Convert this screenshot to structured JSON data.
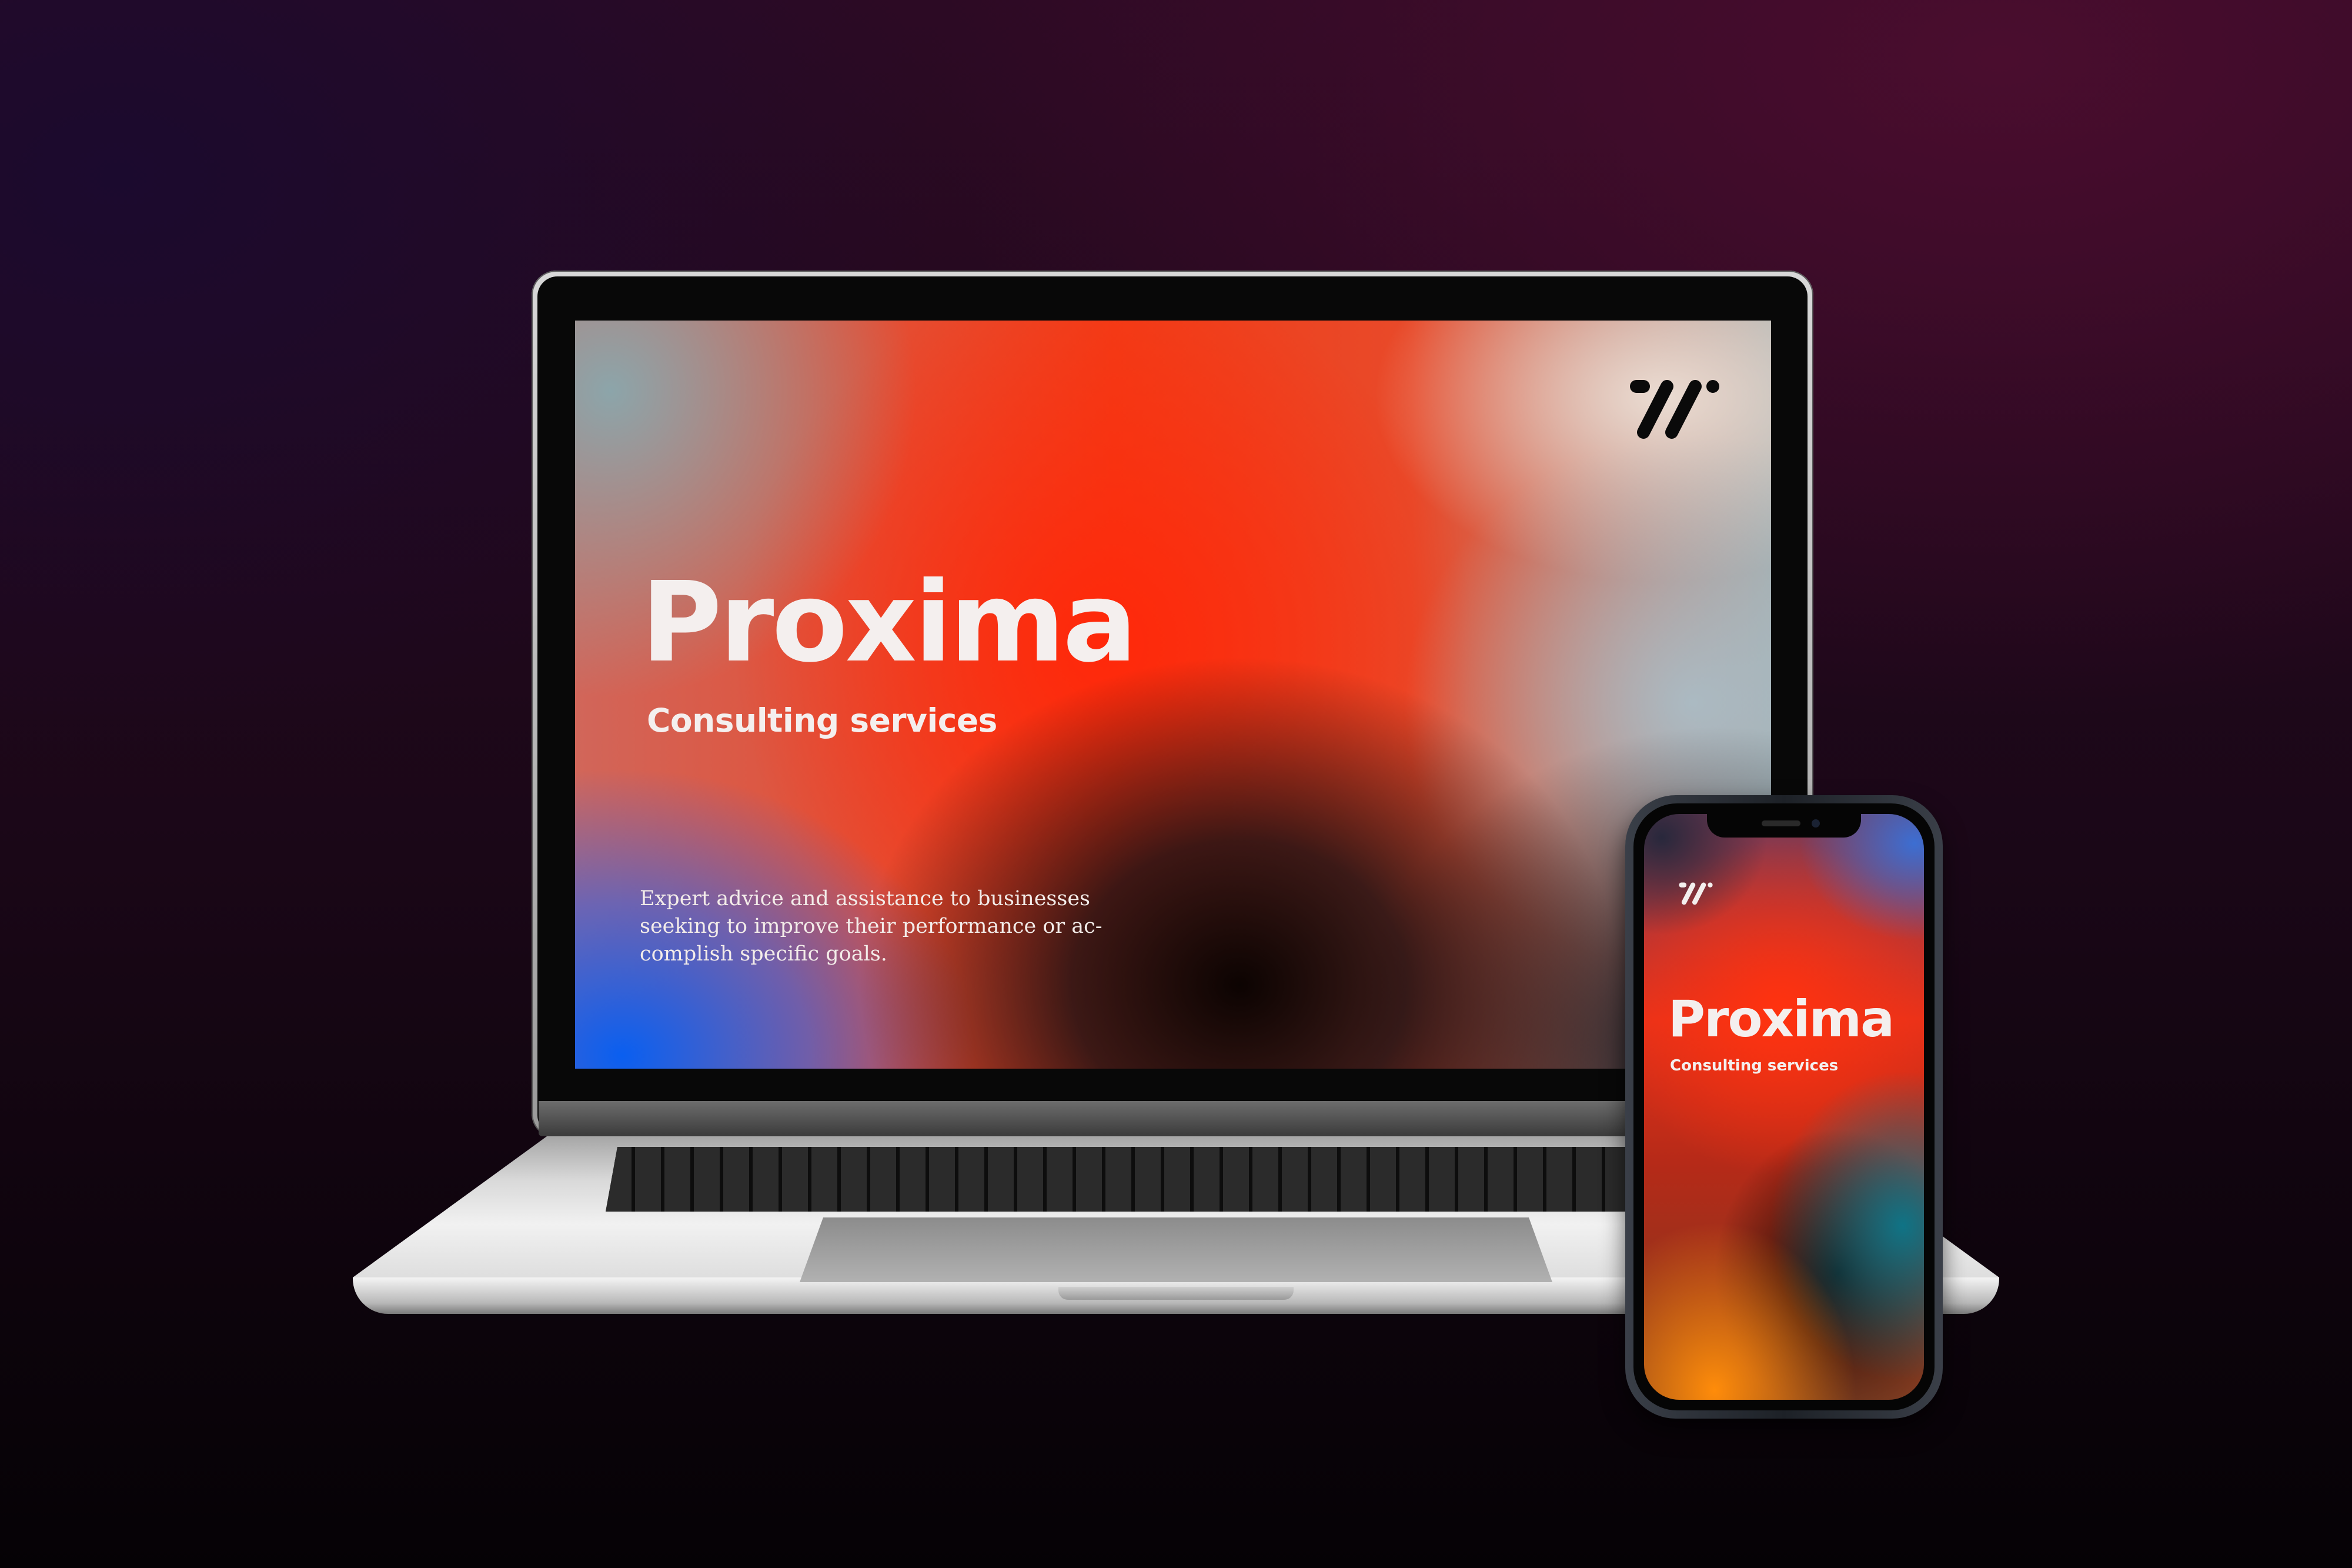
{
  "laptop": {
    "title": "Proxima",
    "subtitle": "Consulting services",
    "description": "Expert advice and assistance to businesses seeking to improve their performance or ac-complish specific goals.",
    "logo_icon": "double-slash-logo-icon"
  },
  "phone": {
    "title": "Proxima",
    "subtitle": "Consulting services",
    "logo_icon": "double-slash-logo-icon"
  },
  "colors": {
    "background": "#2c0a24",
    "accent_red": "#f23c17",
    "accent_blue": "#0a5ff0",
    "text": "#f4efee"
  }
}
